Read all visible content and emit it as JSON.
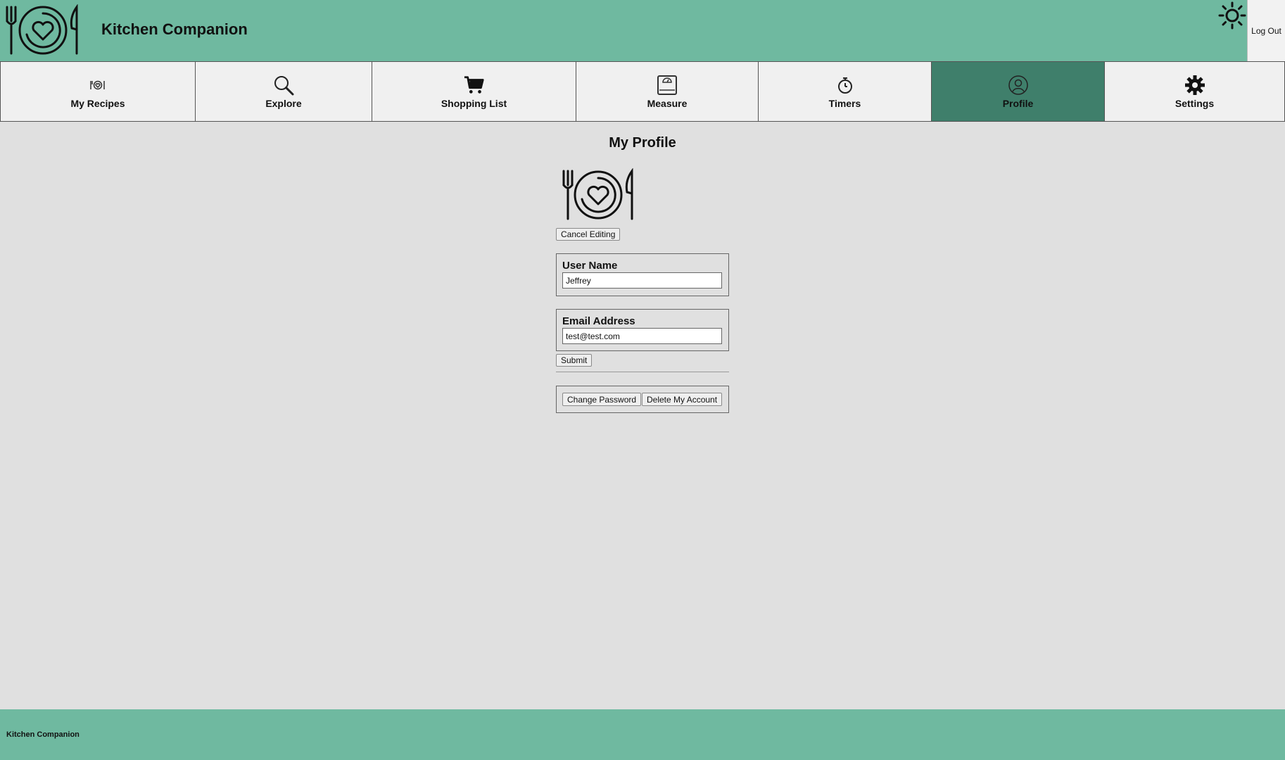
{
  "header": {
    "app_title": "Kitchen Companion",
    "logo_icon": "plate-heart-cutlery-icon",
    "theme_icon": "sun-icon",
    "logout_label": "Log Out",
    "colors": {
      "header_bg": "#6fb9a0",
      "active_tab_bg": "#3f7f6b"
    }
  },
  "nav": {
    "items": [
      {
        "label": "My Recipes",
        "icon": "recipes-icon",
        "active": false
      },
      {
        "label": "Explore",
        "icon": "search-icon",
        "active": false
      },
      {
        "label": "Shopping List",
        "icon": "cart-icon",
        "active": false
      },
      {
        "label": "Measure",
        "icon": "scale-icon",
        "active": false
      },
      {
        "label": "Timers",
        "icon": "stopwatch-icon",
        "active": false
      },
      {
        "label": "Profile",
        "icon": "user-icon",
        "active": true
      },
      {
        "label": "Settings",
        "icon": "gear-icon",
        "active": false
      }
    ]
  },
  "profile": {
    "title": "My Profile",
    "avatar_icon": "plate-heart-cutlery-icon",
    "cancel_label": "Cancel Editing",
    "username": {
      "label": "User Name",
      "value": "Jeffrey"
    },
    "email": {
      "label": "Email Address",
      "value": "test@test.com"
    },
    "submit_label": "Submit",
    "change_password_label": "Change Password",
    "delete_account_label": "Delete My Account"
  },
  "footer": {
    "text": "Kitchen Companion"
  }
}
